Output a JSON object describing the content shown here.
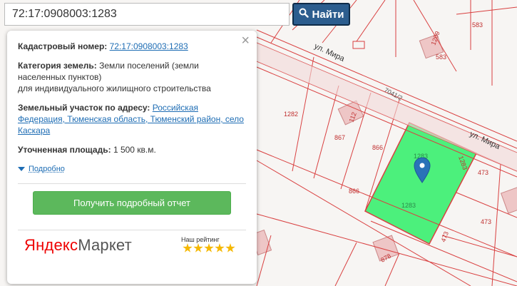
{
  "search": {
    "value": "72:17:0908003:1283",
    "button_label": "Найти"
  },
  "popup": {
    "close_label": "×",
    "cadastral_label": "Кадастровый номер:",
    "cadastral_value": "72:17:0908003:1283",
    "category_label": "Категория земель:",
    "category_value": "Земли поселений (земли населенных пунктов)",
    "category_use": "для индивидуального жилищного строительства",
    "address_label": "Земельный участок по адресу:",
    "address_value": "Российская Федерация, Тюменская область, Тюменский район, село Каскара",
    "area_label": "Уточненная площадь:",
    "area_value": "1 500 кв.м.",
    "more_label": "Подробно",
    "report_button": "Получить подробный отчет",
    "brand_yandex": "Яндекс",
    "brand_market": "Маркет",
    "rating_label": "Наш рейтинг",
    "rating_stars": 5
  },
  "map": {
    "street_1": "ул. Мира",
    "street_2": "ул. Мира",
    "road_label": "7041/2",
    "parcel_labels": [
      "583",
      "583",
      "1209",
      "1282",
      "867",
      "112",
      "866",
      "866",
      "1283",
      "1283",
      "1283",
      "473",
      "473",
      "473",
      "878"
    ],
    "selected_parcel_color": "#4cf07c",
    "boundary_color": "#d94040",
    "pin_color": "#2a72b8"
  },
  "icons": {
    "search": "search-icon",
    "close": "close-icon",
    "pin": "map-pin-icon",
    "toggle": "triangle-down-icon"
  }
}
